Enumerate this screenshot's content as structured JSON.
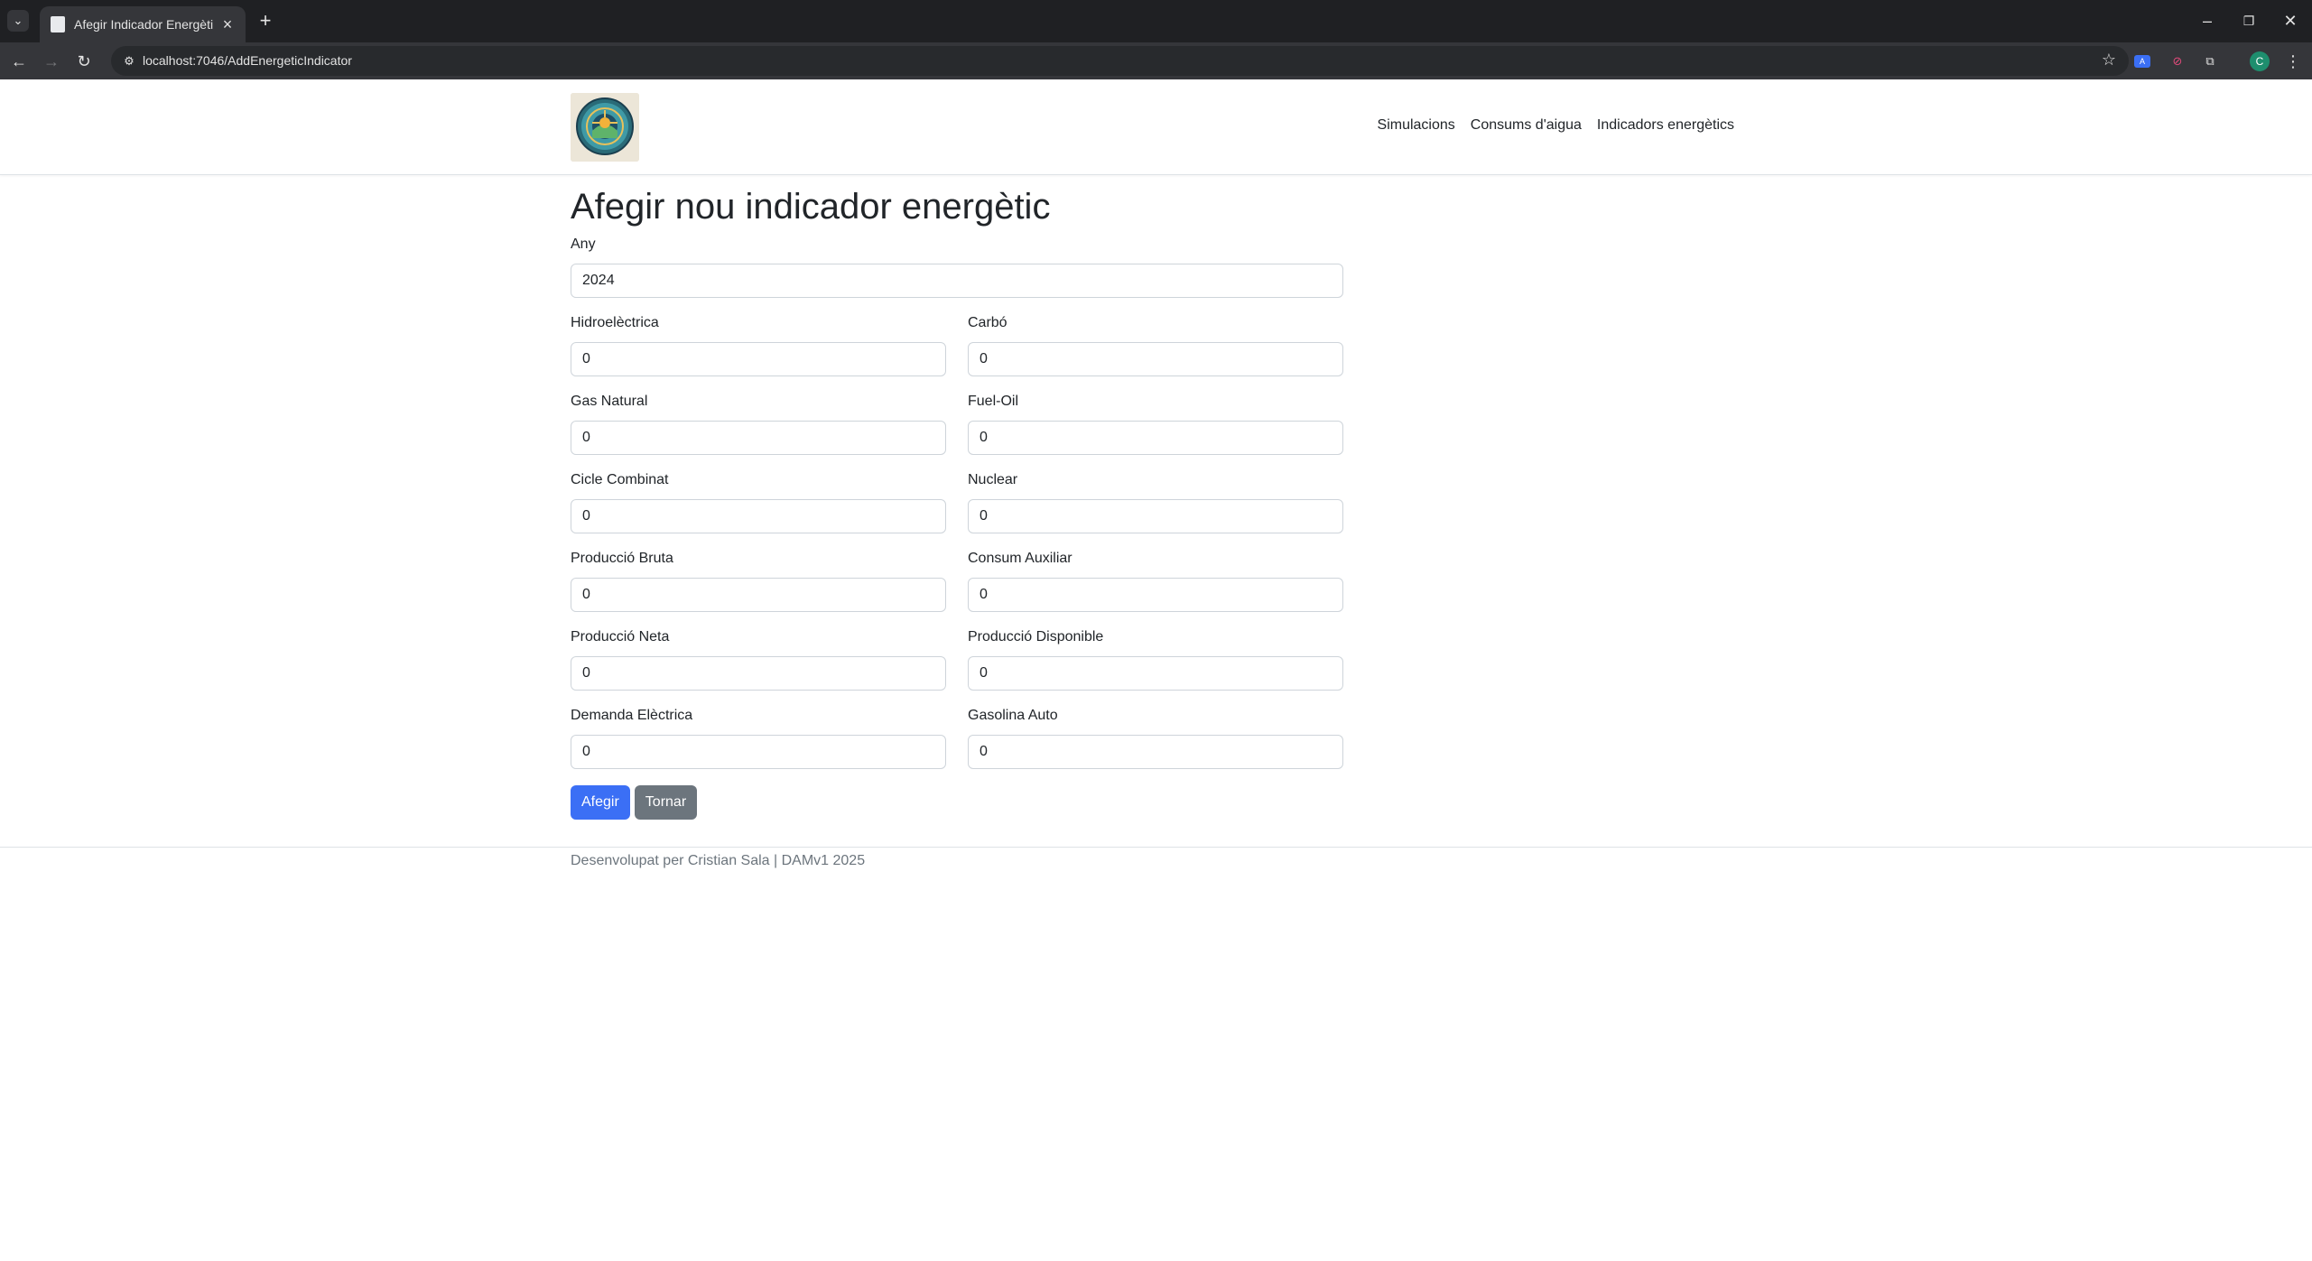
{
  "browser": {
    "tab_title": "Afegir Indicador Energètic - Eco",
    "url": "localhost:7046/AddEnergeticIndicator",
    "profile_initial": "C"
  },
  "header": {
    "nav": [
      "Simulacions",
      "Consums d'aigua",
      "Indicadors energètics"
    ]
  },
  "form": {
    "title": "Afegir nou indicador energètic",
    "year": {
      "label": "Any",
      "value": "2024"
    },
    "rows": [
      [
        {
          "label": "Hidroelèctrica",
          "value": "0"
        },
        {
          "label": "Carbó",
          "value": "0"
        }
      ],
      [
        {
          "label": "Gas Natural",
          "value": "0"
        },
        {
          "label": "Fuel-Oil",
          "value": "0"
        }
      ],
      [
        {
          "label": "Cicle Combinat",
          "value": "0"
        },
        {
          "label": "Nuclear",
          "value": "0"
        }
      ],
      [
        {
          "label": "Producció Bruta",
          "value": "0"
        },
        {
          "label": "Consum Auxiliar",
          "value": "0"
        }
      ],
      [
        {
          "label": "Producció Neta",
          "value": "0"
        },
        {
          "label": "Producció Disponible",
          "value": "0"
        }
      ],
      [
        {
          "label": "Demanda Elèctrica",
          "value": "0"
        },
        {
          "label": "Gasolina Auto",
          "value": "0"
        }
      ]
    ],
    "submit_label": "Afegir",
    "back_label": "Tornar"
  },
  "footer": {
    "text": "Desenvolupat per Cristian Sala | DAMv1 2025"
  },
  "colors": {
    "primary": "#3b6ff5",
    "secondary": "#6c757d",
    "chrome_dark": "#1f2023"
  }
}
